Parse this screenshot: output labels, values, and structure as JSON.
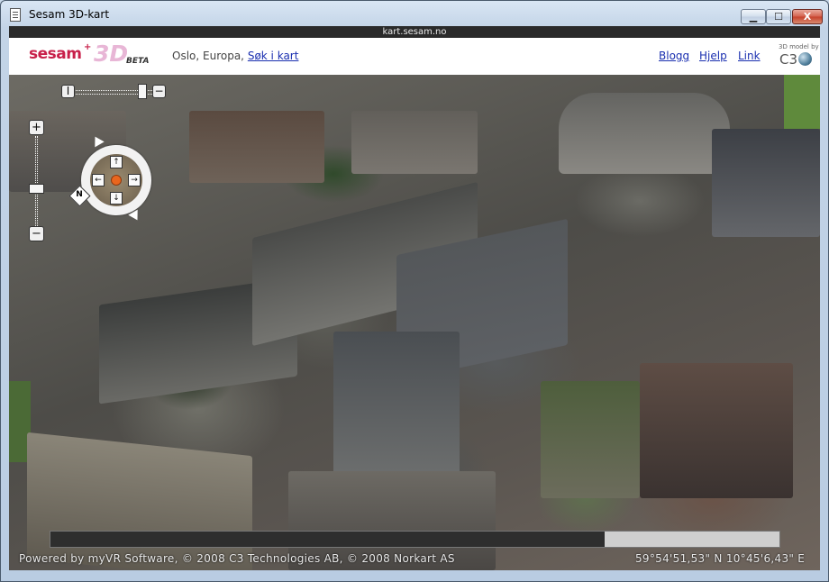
{
  "window": {
    "title": "Sesam 3D-kart",
    "minimize_glyph": "▁",
    "maximize_glyph": "☐",
    "close_glyph": "X"
  },
  "address_bar": {
    "url": "kart.sesam.no"
  },
  "header": {
    "logo": {
      "wordmark": "sesam",
      "plus": "+",
      "mark": "3D",
      "badge": "BETA",
      "brand_color": "#c8204a"
    },
    "location_text": "Oslo, Europa,",
    "search_link": "Søk i kart",
    "nav": [
      "Blogg",
      "Hjelp",
      "Link"
    ],
    "partner_caption": "3D model by",
    "partner_logo": "C3",
    "link_color": "#1a2fb0"
  },
  "map": {
    "horizontal_slider": {
      "minus_label": "I",
      "plus_label": "−",
      "level": 0.92
    },
    "zoom": {
      "plus_label": "+",
      "minus_label": "−",
      "level": 0.4
    },
    "navigation": {
      "up": "↑",
      "down": "↓",
      "left": "←",
      "right": "→",
      "compass_label": "N",
      "center_color": "#e9661e"
    },
    "progress": {
      "value": 0.76
    },
    "attribution": "Powered by myVR Software, © 2008 C3 Technologies AB, © 2008 Norkart AS",
    "coordinates": "59°54'51,53\" N   10°45'6,43\" E"
  }
}
